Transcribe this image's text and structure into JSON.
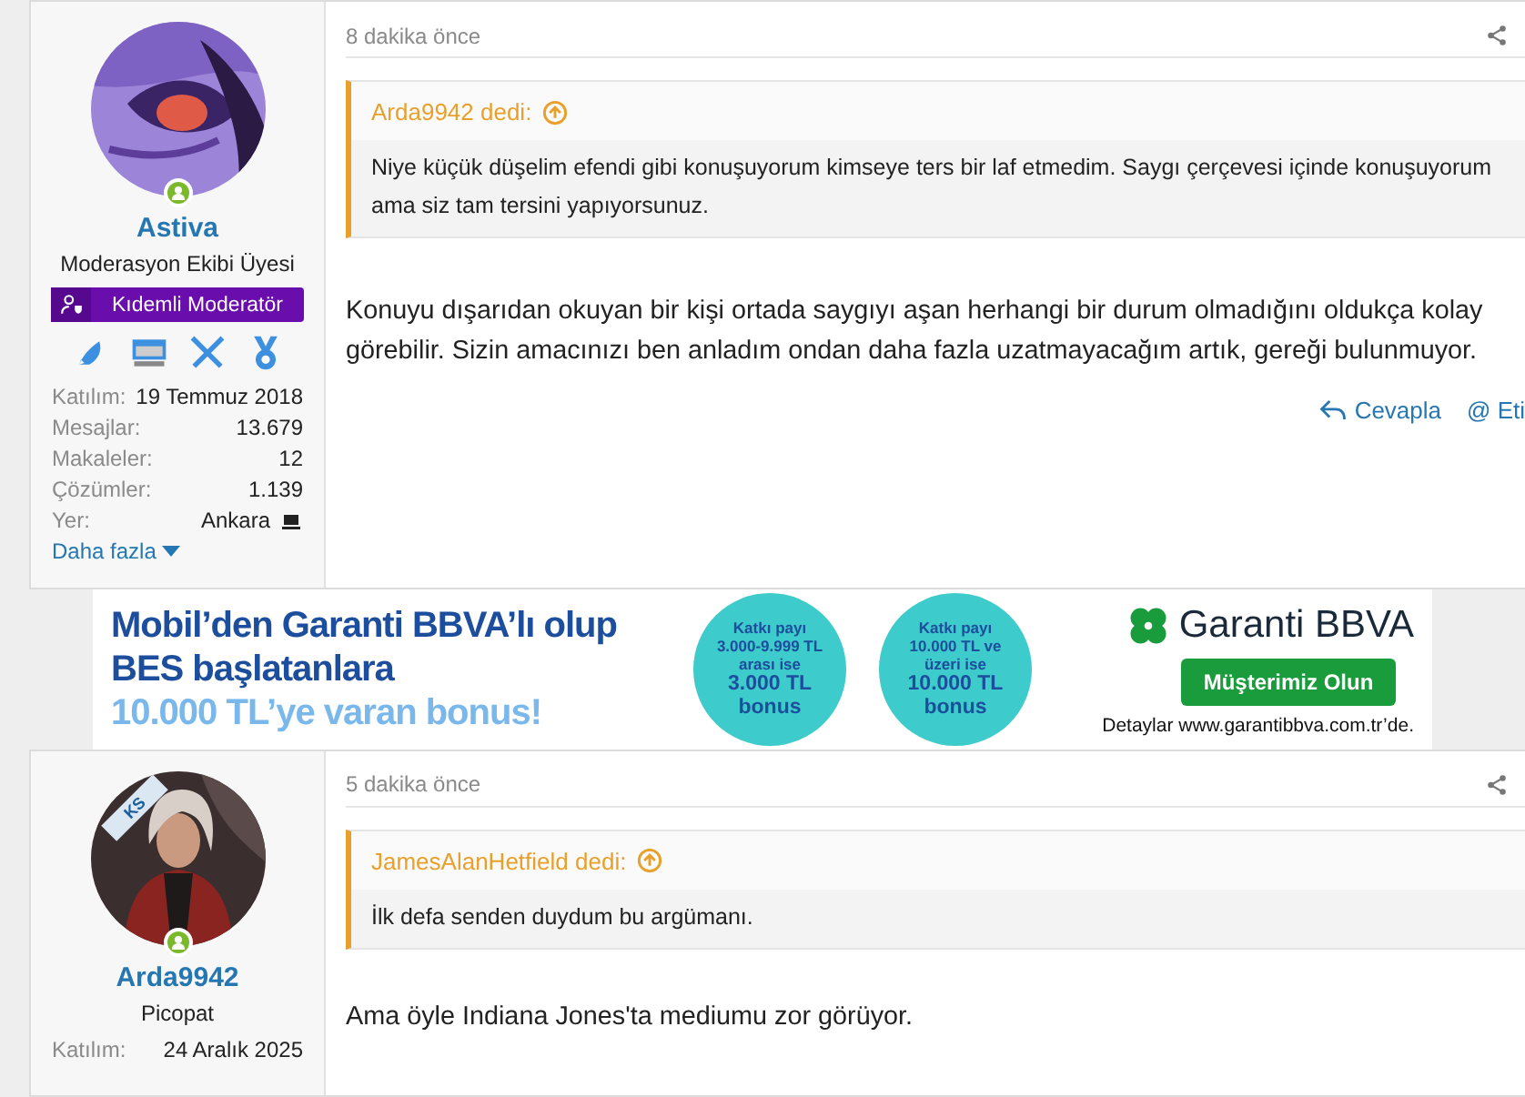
{
  "posts": [
    {
      "author": {
        "name": "Astiva",
        "online": true,
        "title": "Moderasyon Ekibi Üyesi",
        "badge": "Kıdemli Moderatör",
        "stats": [
          {
            "label": "Katılım:",
            "value": "19 Temmuz 2018",
            "kind": "text"
          },
          {
            "label": "Mesajlar:",
            "value": "13.679",
            "kind": "text"
          },
          {
            "label": "Makaleler:",
            "value": "12",
            "kind": "text"
          },
          {
            "label": "Çözümler:",
            "value": "1.139",
            "kind": "text"
          },
          {
            "label": "Yer:",
            "value": "Ankara",
            "kind": "location"
          }
        ],
        "more": "Daha fazla"
      },
      "time": "8 dakika önce",
      "quote": {
        "header": "Arda9942 dedi:",
        "text": "Niye küçük düşelim efendi gibi konuşuyorum kimseye ters bir laf etmedim. Saygı çerçevesi içinde konuşuyorum ama siz tam tersini yapıyorsunuz."
      },
      "body": "Konuyu dışarıdan okuyan bir kişi ortada saygıyı aşan herhangi bir durum olmadığını oldukça kolay görebilir. Sizin amacınızı ben anladım ondan daha fazla uzatmayacağım artık, gereği bulunmuyor.",
      "actions": [
        {
          "label": "Cevapla",
          "kind": "reply"
        },
        {
          "label": "@ Eti",
          "kind": "mention"
        }
      ]
    },
    {
      "author": {
        "name": "Arda9942",
        "ribbon": "KS",
        "online": true,
        "title": "Picopat",
        "stats": [
          {
            "label": "Katılım:",
            "value": "24 Aralık 2025",
            "kind": "text"
          }
        ]
      },
      "time": "5 dakika önce",
      "quote": {
        "header": "JamesAlanHetfield dedi:",
        "text": "İlk defa senden duydum bu argümanı."
      },
      "body": "Ama öyle Indiana Jones'ta mediumu zor görüyor."
    }
  ],
  "ad": {
    "headline": [
      "Mobil’den Garanti BBVA’lı olup",
      "BES başlatanlara"
    ],
    "highlight": "10.000 TL’ye varan bonus!",
    "offers": [
      {
        "lines": [
          "Katkı payı",
          "3.000-9.999 TL",
          "arası ise"
        ],
        "bonus": [
          "3.000 TL",
          "bonus"
        ]
      },
      {
        "lines": [
          "Katkı payı",
          "10.000 TL ve",
          "üzeri ise"
        ],
        "bonus": [
          "10.000 TL",
          "bonus"
        ]
      }
    ],
    "brand": "Garanti BBVA",
    "button": "Müşterimiz Olun",
    "footer": "Detaylar www.garantibbva.com.tr’de."
  }
}
